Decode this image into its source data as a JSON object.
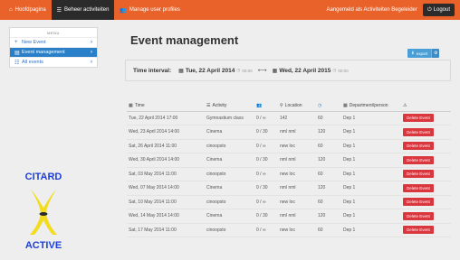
{
  "topbar": {
    "nav": [
      {
        "icon": "home-icon",
        "glyph": "⌂",
        "label": "Hoofdpagina"
      },
      {
        "icon": "list-icon",
        "glyph": "☰",
        "label": "Beheer activiteiten"
      },
      {
        "icon": "users-icon",
        "glyph": "👥",
        "label": "Manage user profiles"
      }
    ],
    "user_text": "Aangemeld als Activiteiten Begeleider",
    "logout_label": "Logout",
    "accent_color": "#e8622a"
  },
  "menu": {
    "title": "MENU",
    "items": [
      {
        "icon": "plus-icon",
        "glyph": "+",
        "label": "New Event"
      },
      {
        "icon": "calendar-icon",
        "glyph": "▤",
        "label": "Event management"
      },
      {
        "icon": "table-icon",
        "glyph": "☷",
        "label": "All events"
      }
    ],
    "chevron": "›"
  },
  "logo": {
    "top_text": "CITARD",
    "bottom_text": "ACTIVE"
  },
  "main": {
    "title": "Event management",
    "export_label": "export",
    "interval": {
      "label": "Time interval:",
      "start_date": "Tue, 22 April 2014",
      "start_time": "00:00",
      "end_date": "Wed, 22 April 2015",
      "end_time": "00:00"
    }
  },
  "table": {
    "headers": {
      "time": "Time",
      "activity": "Activity",
      "location": "Location",
      "department": "Department/person"
    },
    "delete_label": "Delete Event",
    "rows": [
      {
        "time": "Tue, 22 April 2014 17:00",
        "activity": "Gymnastium class",
        "participants": "0 / ∞",
        "location": "142",
        "duration": "60",
        "department": "Dep 1"
      },
      {
        "time": "Wed, 23 April 2014 14:00",
        "activity": "Cinema",
        "participants": "0 / 30",
        "location": "nml nml",
        "duration": "120",
        "department": "Dep 1"
      },
      {
        "time": "Sat, 26 April 2014 11:00",
        "activity": "cinoopsto",
        "participants": "0 / ∞",
        "location": "new loc",
        "duration": "60",
        "department": "Dep 1"
      },
      {
        "time": "Wed, 30 April 2014 14:00",
        "activity": "Cinema",
        "participants": "0 / 30",
        "location": "nml nml",
        "duration": "120",
        "department": "Dep 1"
      },
      {
        "time": "Sat, 03 May 2014 11:00",
        "activity": "cinoopsto",
        "participants": "0 / ∞",
        "location": "new loc",
        "duration": "60",
        "department": "Dep 1"
      },
      {
        "time": "Wed, 07 May 2014 14:00",
        "activity": "Cinema",
        "participants": "0 / 30",
        "location": "nml nml",
        "duration": "120",
        "department": "Dep 1"
      },
      {
        "time": "Sat, 10 May 2014 11:00",
        "activity": "cinoopsto",
        "participants": "0 / ∞",
        "location": "new loc",
        "duration": "60",
        "department": "Dep 1"
      },
      {
        "time": "Wed, 14 May 2014 14:00",
        "activity": "Cinema",
        "participants": "0 / 30",
        "location": "nml nml",
        "duration": "120",
        "department": "Dep 1"
      },
      {
        "time": "Sat, 17 May 2014 11:00",
        "activity": "cinoopsto",
        "participants": "0 / ∞",
        "location": "new loc",
        "duration": "60",
        "department": "Dep 1"
      }
    ]
  }
}
